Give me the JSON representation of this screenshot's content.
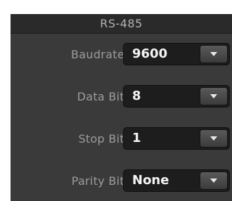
{
  "panel": {
    "title": "RS-485",
    "fields": [
      {
        "label": "Baudrate",
        "value": "9600"
      },
      {
        "label": "Data Bit",
        "value": "8"
      },
      {
        "label": "Stop Bit",
        "value": "1"
      },
      {
        "label": "Parity Bit",
        "value": "None"
      }
    ]
  },
  "icons": {
    "dropdown": "chevron-down-icon"
  },
  "colors": {
    "panel_bg": "#3a3a3a",
    "header_bg": "#2a2a2a",
    "label_text": "#9c9c9c",
    "value_text": "#f4f4f4",
    "select_bg": "#1d1d1d"
  }
}
